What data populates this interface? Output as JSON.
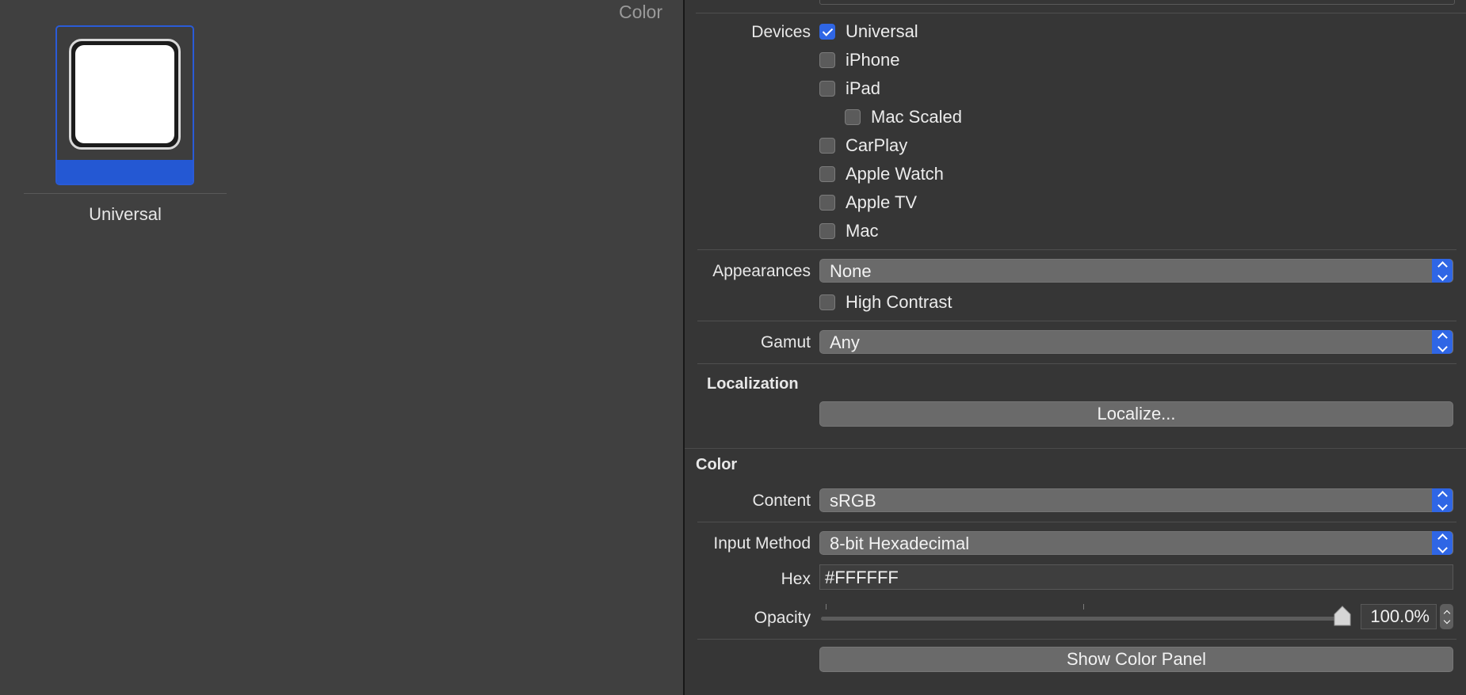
{
  "canvas": {
    "section_title": "Color",
    "swatch_label": "Universal"
  },
  "inspector": {
    "devices": {
      "label": "Devices",
      "items": [
        {
          "label": "Universal",
          "checked": true
        },
        {
          "label": "iPhone",
          "checked": false
        },
        {
          "label": "iPad",
          "checked": false
        },
        {
          "label": "Mac Scaled",
          "checked": false
        },
        {
          "label": "CarPlay",
          "checked": false
        },
        {
          "label": "Apple Watch",
          "checked": false
        },
        {
          "label": "Apple TV",
          "checked": false
        },
        {
          "label": "Mac",
          "checked": false
        }
      ]
    },
    "appearances": {
      "label": "Appearances",
      "value": "None",
      "high_contrast_label": "High Contrast"
    },
    "gamut": {
      "label": "Gamut",
      "value": "Any"
    },
    "localization": {
      "heading": "Localization",
      "button_label": "Localize..."
    },
    "color": {
      "heading": "Color",
      "content_label": "Content",
      "content_value": "sRGB",
      "input_method_label": "Input Method",
      "input_method_value": "8-bit Hexadecimal",
      "hex_label": "Hex",
      "hex_value": "#FFFFFF",
      "opacity_label": "Opacity",
      "opacity_value": "100.0%",
      "opacity_fraction": 1.0,
      "show_panel_label": "Show Color Panel"
    }
  },
  "colors": {
    "accent": "#2f66e5",
    "swatch": "#ffffff",
    "background": "#404040",
    "panel": "#363636"
  }
}
